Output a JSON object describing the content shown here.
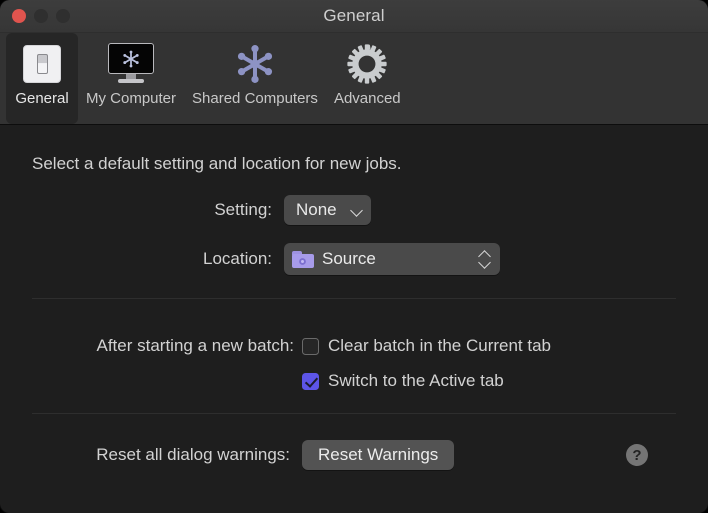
{
  "window": {
    "title": "General",
    "traffic_lights": [
      {
        "name": "close",
        "color": "#e0544e"
      },
      {
        "name": "minimize",
        "color": "#2f2f2f"
      },
      {
        "name": "zoom",
        "color": "#2f2f2f"
      }
    ]
  },
  "toolbar": {
    "items": [
      {
        "label": "General",
        "icon": "light-switch-icon",
        "selected": true
      },
      {
        "label": "My Computer",
        "icon": "monitor-icon",
        "selected": false
      },
      {
        "label": "Shared Computers",
        "icon": "network-node-icon",
        "selected": false
      },
      {
        "label": "Advanced",
        "icon": "gear-icon",
        "selected": false
      }
    ]
  },
  "content": {
    "intro": "Select a default setting and location for new jobs.",
    "setting": {
      "label": "Setting:",
      "value": "None",
      "chevron": "chevron-down-icon"
    },
    "location": {
      "label": "Location:",
      "value": "Source",
      "folder_icon": "smart-folder-icon",
      "stepper": "up-down-stepper-icon"
    },
    "batch": {
      "label": "After starting a new batch:",
      "options": [
        {
          "label": "Clear batch in the Current tab",
          "checked": false
        },
        {
          "label": "Switch to the Active tab",
          "checked": true
        }
      ]
    },
    "reset": {
      "label": "Reset all dialog warnings:",
      "button_label": "Reset Warnings"
    },
    "help": {
      "glyph": "?",
      "icon": "help-icon"
    }
  },
  "colors": {
    "titlebar": "#3a3a3a",
    "toolbar": "#333333",
    "content": "#1e1e1e",
    "selected_tab": "#262626",
    "accent_checkbox": "#5d55e8",
    "folder_purple": "#a79bea",
    "node_blue": "#8d93c4",
    "text": "#d2d2d2"
  }
}
